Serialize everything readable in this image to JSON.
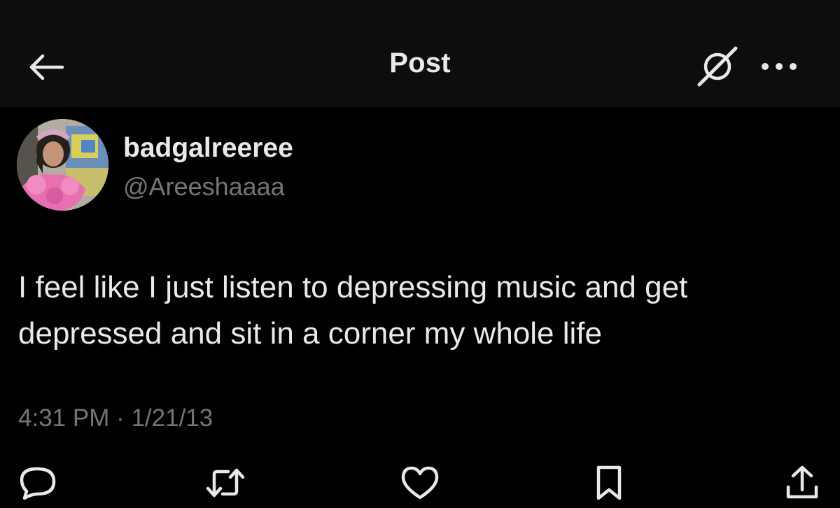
{
  "header": {
    "title": "Post",
    "back_icon": "arrow-left-icon",
    "grok_icon": "grok-icon",
    "more_icon": "more-horizontal-icon"
  },
  "author": {
    "display_name": "badgalreeree",
    "handle": "@Areeshaaaa",
    "avatar_icon": "profile-photo"
  },
  "post": {
    "text": "I feel like I just listen to depressing music and get depressed and sit in a corner my whole life",
    "timestamp": "4:31 PM · 1/21/13"
  },
  "actions": [
    {
      "name": "reply",
      "icon": "speech-bubble-icon"
    },
    {
      "name": "repost",
      "icon": "repost-arrows-icon"
    },
    {
      "name": "like",
      "icon": "heart-icon"
    },
    {
      "name": "bookmark",
      "icon": "bookmark-icon"
    },
    {
      "name": "share",
      "icon": "share-upload-icon"
    }
  ],
  "colors": {
    "background": "#000000",
    "header_background": "#0d0d0d",
    "primary_text": "#e7e9ea",
    "secondary_text": "#71767b"
  }
}
